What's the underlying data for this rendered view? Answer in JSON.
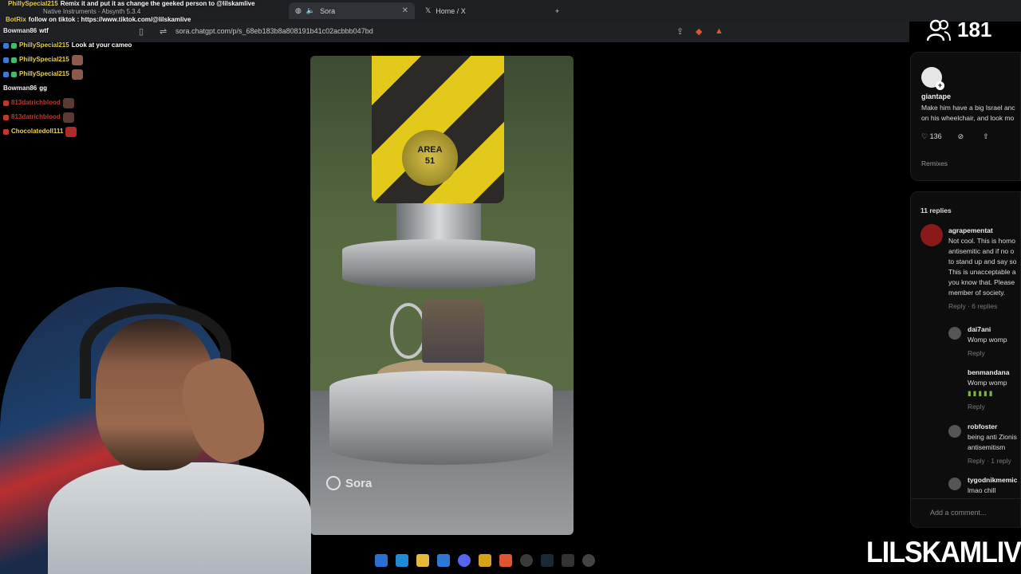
{
  "browser": {
    "tabs": [
      {
        "label": "Sora",
        "active": true
      },
      {
        "label": "Home / X",
        "active": false
      }
    ],
    "new_tab": "+",
    "close": "✕",
    "url": "sora.chatgpt.com/p/s_68eb183b8a808191b41c02acbbb047bd"
  },
  "chat": {
    "lines": [
      {
        "user": "PhillySpecial215",
        "color": "yellow",
        "text": "Remix it and put it as change the geeked person to @lilskamlive"
      },
      {
        "user": "",
        "color": "white",
        "text": "Native Instruments - Absynth 5.3.4"
      },
      {
        "user": "BotRix",
        "color": "yellow",
        "text": "follow on tiktok : https://www.tiktok.com/@lilskamlive"
      },
      {
        "user": "Bowman86",
        "color": "white",
        "text": "wtf"
      },
      {
        "user": "PhillySpecial215",
        "color": "yellow",
        "text": "Look at your cameo"
      },
      {
        "user": "PhillySpecial215",
        "color": "yellow",
        "text": ""
      },
      {
        "user": "PhillySpecial215",
        "color": "yellow",
        "text": ""
      },
      {
        "user": "Bowman86",
        "color": "white",
        "text": "gg"
      },
      {
        "user": "813datrichblood",
        "color": "red",
        "text": ""
      },
      {
        "user": "813datrichblood",
        "color": "red",
        "text": ""
      },
      {
        "user": "Chocolatedoll111",
        "color": "yellow",
        "text": ""
      }
    ]
  },
  "video": {
    "piston_label_line1": "AREA",
    "piston_label_line2": "51",
    "watermark": "Sora"
  },
  "post": {
    "author": "giantape",
    "caption_line1": "Make him have a big Israel anc",
    "caption_line2": "on his wheelchair, and look mo",
    "likes": "136",
    "remixes_label": "Remixes"
  },
  "comments": {
    "count_label": "11 replies",
    "main": {
      "user": "agrapementat",
      "lines": [
        "Not cool. This is homo",
        "antisemitic and if no o",
        "to stand up and say so",
        "This is unacceptable a",
        "you know that. Please",
        "member of society."
      ],
      "meta": "Reply · 6 replies"
    },
    "replies": [
      {
        "user": "dai7ani",
        "lines": [
          "Womp womp"
        ],
        "meta": "Reply"
      },
      {
        "user": "benmandana",
        "lines": [
          "Womp womp"
        ],
        "meta": "Reply"
      },
      {
        "user": "robfoster",
        "lines": [
          "being anti Zionis",
          "antisemitism"
        ],
        "meta": "Reply · 1 reply"
      },
      {
        "user": "tygodnikmemic",
        "lines": [
          "lmao chill"
        ],
        "meta": ""
      }
    ],
    "add_placeholder": "Add a comment..."
  },
  "viewer_count": "181",
  "brand": "LILSKAMLIVE",
  "colors": {
    "chat_yellow": "#e8d24a",
    "chat_red": "#c0392b",
    "piston_yellow": "#e3c919"
  }
}
